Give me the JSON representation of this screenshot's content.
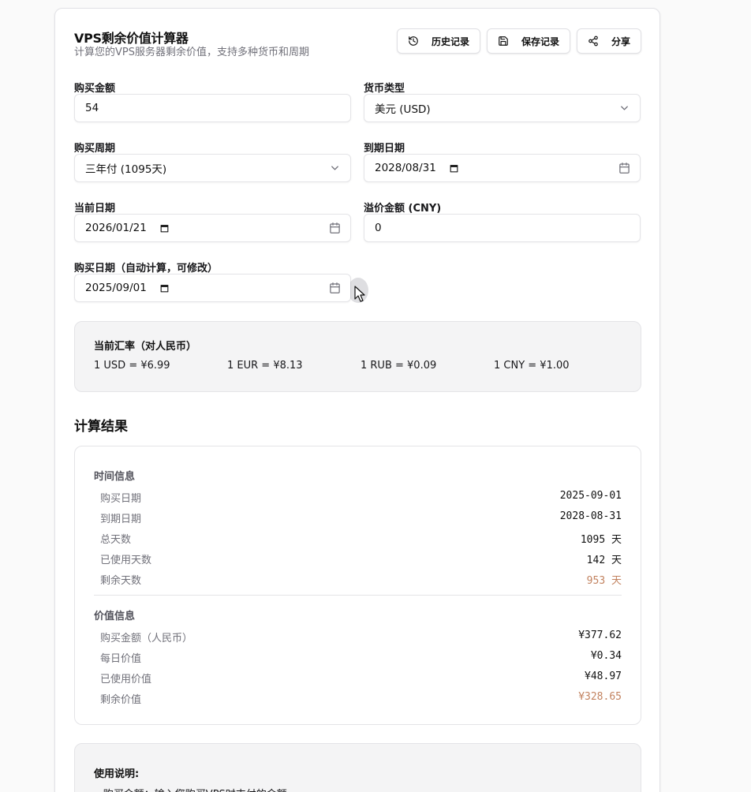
{
  "header": {
    "title": "VPS剩余价值计算器",
    "subtitle": "计算您的VPS服务器剩余价值，支持多种货币和周期",
    "buttons": {
      "history": "历史记录",
      "save": "保存记录",
      "share": "分享"
    }
  },
  "form": {
    "amount": {
      "label": "购买金额",
      "value": "54"
    },
    "currency": {
      "label": "货币类型",
      "value": "美元 (USD)"
    },
    "cycle": {
      "label": "购买周期",
      "value": "三年付 (1095天)"
    },
    "expiry": {
      "label": "到期日期",
      "value": "2028/08/31"
    },
    "current_date": {
      "label": "当前日期",
      "value": "2026/01/21"
    },
    "premium": {
      "label": "溢价金额 (CNY)",
      "value": "0"
    },
    "purchase_date": {
      "label": "购买日期（自动计算，可修改）",
      "value": "2025/09/01"
    }
  },
  "rates": {
    "title": "当前汇率（对人民币）",
    "items": [
      "1 USD = ¥6.99",
      "1 EUR = ¥8.13",
      "1 RUB = ¥0.09",
      "1 CNY = ¥1.00"
    ]
  },
  "results": {
    "title": "计算结果",
    "time_group": {
      "title": "时间信息",
      "rows": [
        {
          "label": "购买日期",
          "value": "2025-09-01",
          "unit": ""
        },
        {
          "label": "到期日期",
          "value": "2028-08-31",
          "unit": ""
        },
        {
          "label": "总天数",
          "value": "1095",
          "unit": "天"
        },
        {
          "label": "已使用天数",
          "value": "142",
          "unit": "天"
        },
        {
          "label": "剩余天数",
          "value": "953",
          "unit": "天"
        }
      ]
    },
    "value_group": {
      "title": "价值信息",
      "rows": [
        {
          "label": "购买金额（人民币）",
          "value": "¥377.62"
        },
        {
          "label": "每日价值",
          "value": "¥0.34"
        },
        {
          "label": "已使用价值",
          "value": "¥48.97"
        },
        {
          "label": "剩余价值",
          "value": "¥328.65"
        }
      ]
    }
  },
  "usage": {
    "title": "使用说明:",
    "first_item": "• 购买金额：输入您购买VPS时支付的金额"
  },
  "colors": {
    "accent": "#c2825f",
    "muted": "#71717a",
    "border": "#e4e4e7"
  }
}
